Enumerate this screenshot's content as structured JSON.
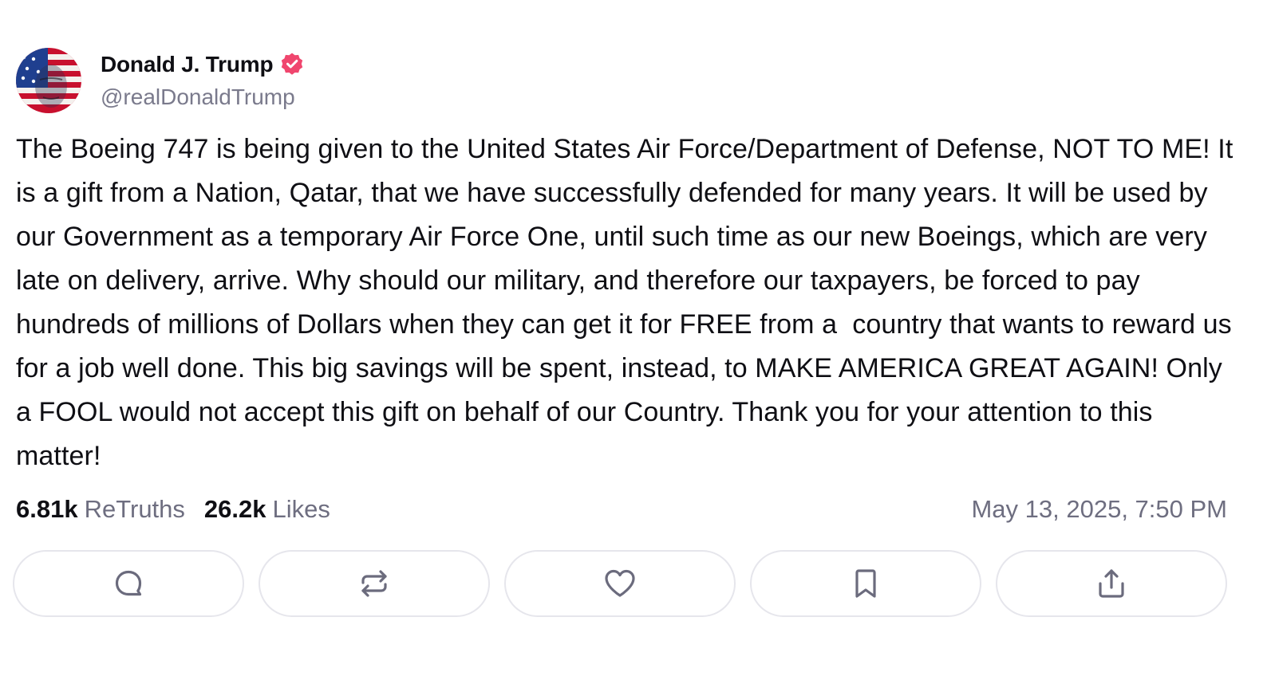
{
  "author": {
    "display_name": "Donald J. Trump",
    "handle": "@realDonaldTrump",
    "verified": true,
    "verified_color": "#f0466e"
  },
  "post": {
    "text": "The Boeing 747 is being given to the United States Air Force/Department of Defense, NOT TO ME! It is a gift from a Nation, Qatar, that we have successfully defended for many years. It will be used by our Government as a temporary Air Force One, until such time as our new Boeings, which are very late on delivery, arrive. Why should our military, and therefore our taxpayers, be forced to pay hundreds of millions of Dollars when they can get it for FREE from a  country that wants to reward us for a job well done. This big savings will be spent, instead, to MAKE AMERICA GREAT AGAIN! Only a FOOL would not accept this gift on behalf of our Country. Thank you for your attention to this matter!"
  },
  "stats": {
    "retruths_count": "6.81k",
    "retruths_label": "ReTruths",
    "likes_count": "26.2k",
    "likes_label": "Likes",
    "timestamp": "May 13, 2025, 7:50 PM"
  },
  "actions": [
    {
      "icon": "reply-icon"
    },
    {
      "icon": "retruth-icon"
    },
    {
      "icon": "heart-icon"
    },
    {
      "icon": "bookmark-icon"
    },
    {
      "icon": "share-icon"
    }
  ],
  "colors": {
    "text": "#0f0f14",
    "muted": "#6e6e80",
    "border": "#e6e6ec",
    "icon": "#6b6b7d"
  }
}
